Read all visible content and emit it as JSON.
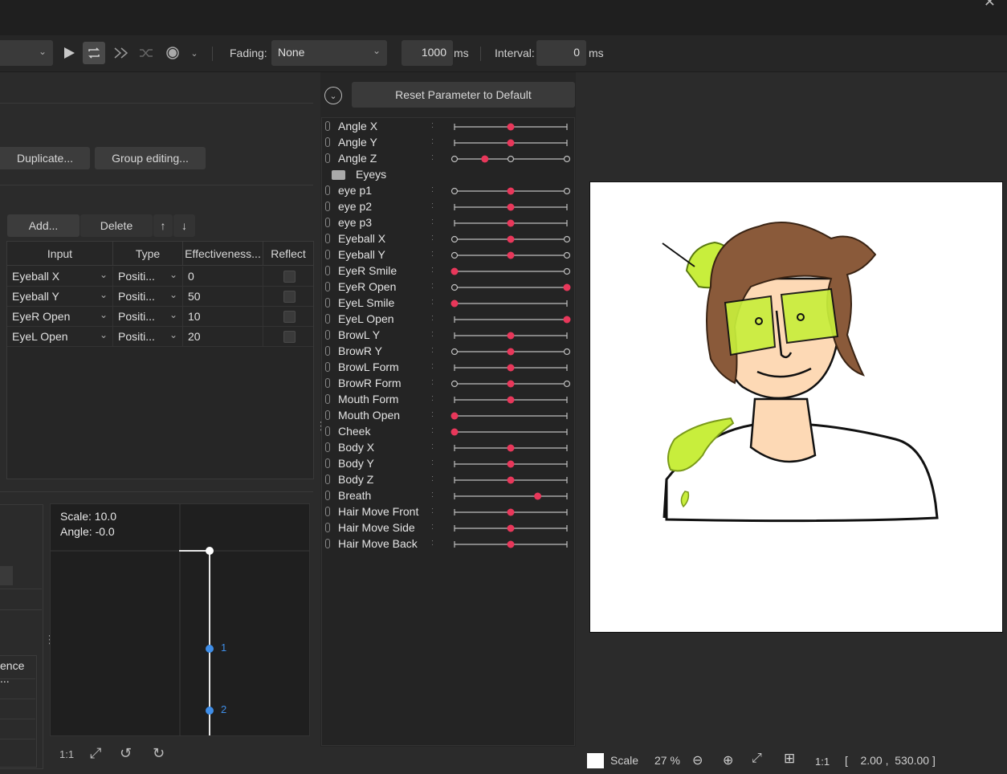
{
  "toolbar": {
    "fading_label": "Fading:",
    "fading_value": "None",
    "duration_value": "1000",
    "duration_unit": "ms",
    "interval_label": "Interval:",
    "interval_value": "0",
    "interval_unit": "ms"
  },
  "param_panel": {
    "reset_label": "Reset Parameter to Default",
    "rows": [
      {
        "kind": "param",
        "name": "Angle X",
        "value": 0.5,
        "ends": "bar"
      },
      {
        "kind": "param",
        "name": "Angle Y",
        "value": 0.5,
        "ends": "bar"
      },
      {
        "kind": "param",
        "name": "Angle Z",
        "value": 0.27,
        "ends": "circle"
      },
      {
        "kind": "folder",
        "name": "Eyeys"
      },
      {
        "kind": "param",
        "name": "eye p1",
        "value": 0.5,
        "ends": "circle"
      },
      {
        "kind": "param",
        "name": "eye p2",
        "value": 0.5,
        "ends": "bar"
      },
      {
        "kind": "param",
        "name": "eye p3",
        "value": 0.5,
        "ends": "bar"
      },
      {
        "kind": "param",
        "name": "Eyeball X",
        "value": 0.5,
        "ends": "circle"
      },
      {
        "kind": "param",
        "name": "Eyeball Y",
        "value": 0.5,
        "ends": "circle"
      },
      {
        "kind": "param",
        "name": "EyeR Smile",
        "value": 0.0,
        "ends": "circle"
      },
      {
        "kind": "param",
        "name": "EyeR Open",
        "value": 1.0,
        "ends": "circle"
      },
      {
        "kind": "param",
        "name": "EyeL Smile",
        "value": 0.0,
        "ends": "bar"
      },
      {
        "kind": "param",
        "name": "EyeL Open",
        "value": 1.0,
        "ends": "bar"
      },
      {
        "kind": "param",
        "name": "BrowL Y",
        "value": 0.5,
        "ends": "bar"
      },
      {
        "kind": "param",
        "name": "BrowR Y",
        "value": 0.5,
        "ends": "circle"
      },
      {
        "kind": "param",
        "name": "BrowL Form",
        "value": 0.5,
        "ends": "bar"
      },
      {
        "kind": "param",
        "name": "BrowR Form",
        "value": 0.5,
        "ends": "circle"
      },
      {
        "kind": "param",
        "name": "Mouth Form",
        "value": 0.5,
        "ends": "bar"
      },
      {
        "kind": "param",
        "name": "Mouth Open",
        "value": 0.0,
        "ends": "bar"
      },
      {
        "kind": "param",
        "name": "Cheek",
        "value": 0.0,
        "ends": "bar"
      },
      {
        "kind": "param",
        "name": "Body X",
        "value": 0.5,
        "ends": "bar"
      },
      {
        "kind": "param",
        "name": "Body Y",
        "value": 0.5,
        "ends": "bar"
      },
      {
        "kind": "param",
        "name": "Body Z",
        "value": 0.5,
        "ends": "bar"
      },
      {
        "kind": "param",
        "name": "Breath",
        "value": 0.74,
        "ends": "bar"
      },
      {
        "kind": "param",
        "name": "Hair Move Front",
        "value": 0.5,
        "ends": "bar"
      },
      {
        "kind": "param",
        "name": "Hair Move Side",
        "value": 0.5,
        "ends": "bar"
      },
      {
        "kind": "param",
        "name": "Hair Move Back",
        "value": 0.5,
        "ends": "bar"
      }
    ]
  },
  "left": {
    "duplicate_label": "Duplicate...",
    "group_label": "Group editing...",
    "add_label": "Add...",
    "delete_label": "Delete",
    "up_label": "↑",
    "down_label": "↓",
    "columns": [
      "Input",
      "Type",
      "Effectiveness...",
      "Reflect"
    ],
    "rows": [
      {
        "input": "Eyeball X",
        "type": "Positi...",
        "eff": "0"
      },
      {
        "input": "Eyeball Y",
        "type": "Positi...",
        "eff": "50"
      },
      {
        "input": "EyeR Open",
        "type": "Positi...",
        "eff": "10"
      },
      {
        "input": "EyeL Open",
        "type": "Positi...",
        "eff": "20"
      }
    ],
    "side_label": "ence ..."
  },
  "graph": {
    "scale_text": "Scale: 10.0",
    "angle_text": "Angle: -0.0",
    "point1": "1",
    "point2": "2",
    "zoom_label": "1:1"
  },
  "status": {
    "scale_label": "Scale",
    "scale_value": "27 %",
    "ratio_label": "1:1",
    "coords": "[    2.00 ,  530.00 ]"
  },
  "colors": {
    "accent_red": "#e8375a",
    "graph_blue": "#3f8ee8",
    "hair": "#8a5a3a",
    "lime": "#c8ee3c",
    "skin": "#fdd9b5"
  }
}
